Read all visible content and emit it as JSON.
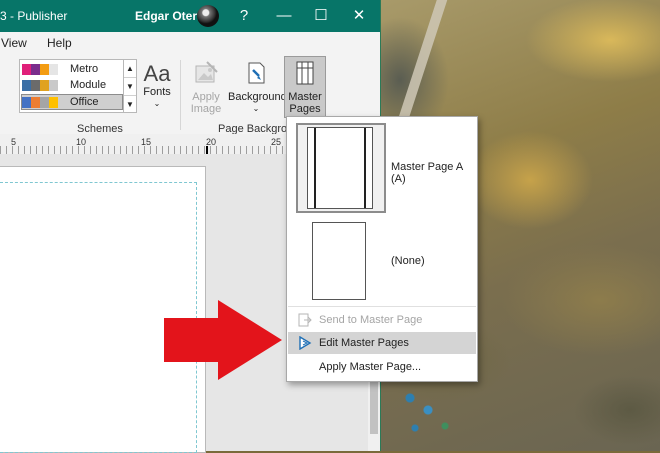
{
  "window": {
    "title": "3  -  Publisher",
    "user_name": "Edgar Otero",
    "help_label": "?",
    "minimize_label": "—",
    "maximize_label": "☐",
    "close_label": "✕"
  },
  "menu": {
    "items": [
      "View",
      "Help"
    ]
  },
  "ribbon": {
    "schemes": {
      "items": [
        {
          "label": "Metro",
          "colors": [
            "#e0207a",
            "#7a2d8c",
            "#f39c12",
            "#e5e5e5"
          ]
        },
        {
          "label": "Module",
          "colors": [
            "#3a6ea5",
            "#6b6b6b",
            "#e0a220",
            "#c9c9c9"
          ]
        },
        {
          "label": "Office",
          "colors": [
            "#4472c4",
            "#ed7d31",
            "#a5a5a5",
            "#ffc000"
          ]
        }
      ],
      "selected": "Office",
      "group_label": "Schemes"
    },
    "fonts_label": "Fonts",
    "fonts_glyph": "Aa",
    "apply_image_label": [
      "Apply",
      "Image"
    ],
    "background_label": "Background",
    "master_pages_label": [
      "Master",
      "Pages"
    ],
    "page_background_group_label": "Page Background"
  },
  "ruler": {
    "labels": [
      "5",
      "10",
      "15",
      "20",
      "25"
    ]
  },
  "dropdown": {
    "thumbnails": [
      {
        "caption": "Master Page A (A)",
        "selected": true
      },
      {
        "caption": "(None)",
        "selected": false
      }
    ],
    "commands": [
      {
        "label": "Send to Master Page",
        "enabled": false,
        "hovered": false,
        "icon": "send-to-master-icon"
      },
      {
        "label": "Edit Master Pages",
        "enabled": true,
        "hovered": true,
        "icon": "edit-master-icon"
      },
      {
        "label": "Apply Master Page...",
        "enabled": true,
        "hovered": false,
        "icon": ""
      }
    ]
  },
  "annotation": {
    "arrow_color": "#e3141b"
  },
  "colors": {
    "titlebar": "#077568",
    "hover": "#d4d4d4"
  }
}
